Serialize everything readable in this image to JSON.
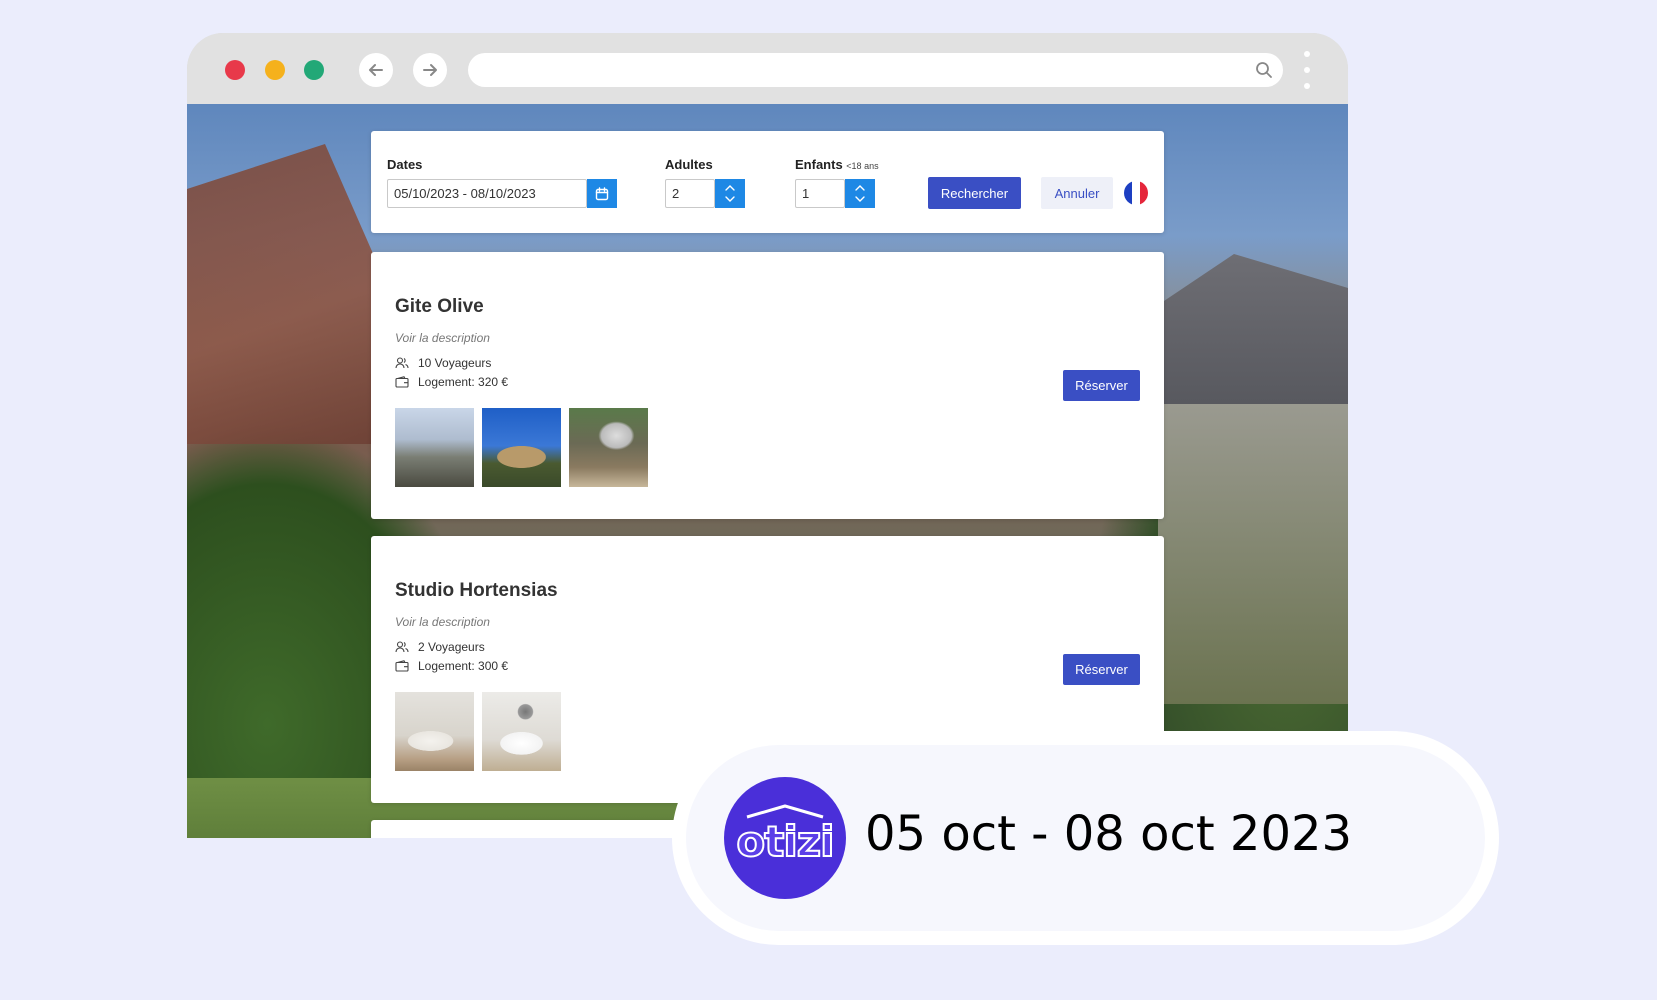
{
  "browser": {
    "url": ""
  },
  "search": {
    "dates_label": "Dates",
    "dates_value": "05/10/2023 - 08/10/2023",
    "adults_label": "Adultes",
    "adults_value": "2",
    "children_label": "Enfants",
    "children_note": "<18 ans",
    "children_value": "1",
    "search_button": "Rechercher",
    "cancel_button": "Annuler",
    "language_flag": "fr"
  },
  "listings": [
    {
      "title": "Gite Olive",
      "description_link": "Voir la description",
      "guests": "10 Voyageurs",
      "price": "Logement: 320 €",
      "photo_count": 3,
      "reserve_button": "Réserver"
    },
    {
      "title": "Studio Hortensias",
      "description_link": "Voir la description",
      "guests": "2 Voyageurs",
      "price": "Logement: 300 €",
      "photo_count": 2,
      "reserve_button": "Réserver"
    }
  ],
  "badge": {
    "logo_text": "otizi",
    "date_range": "05 oct - 08 oct 2023"
  },
  "colors": {
    "background": "#ebedfc",
    "primary": "#3a4fc4",
    "accent_blue": "#1e88e5",
    "logo": "#4a2fd9"
  }
}
